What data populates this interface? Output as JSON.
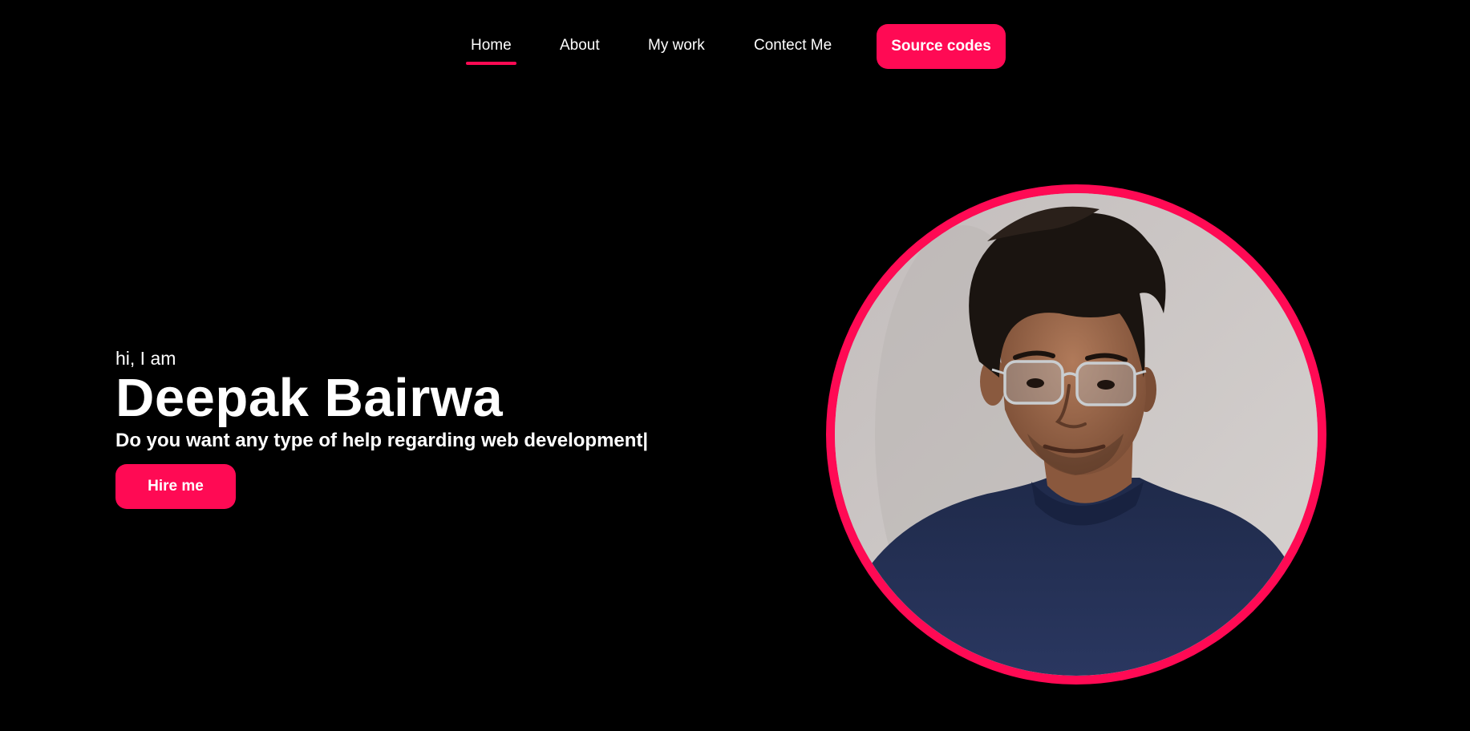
{
  "nav": {
    "items": [
      {
        "label": "Home",
        "active": true
      },
      {
        "label": "About",
        "active": false
      },
      {
        "label": "My work",
        "active": false
      },
      {
        "label": "Contect Me",
        "active": false
      }
    ],
    "source_button": "Source codes"
  },
  "hero": {
    "greeting": "hi, I am",
    "name": "Deepak Bairwa",
    "tagline": "Do you want any type of help regarding web development",
    "cursor": "|",
    "hire_button": "Hire me"
  },
  "colors": {
    "background": "#000000",
    "accent": "#ff0a54",
    "text": "#ffffff"
  }
}
